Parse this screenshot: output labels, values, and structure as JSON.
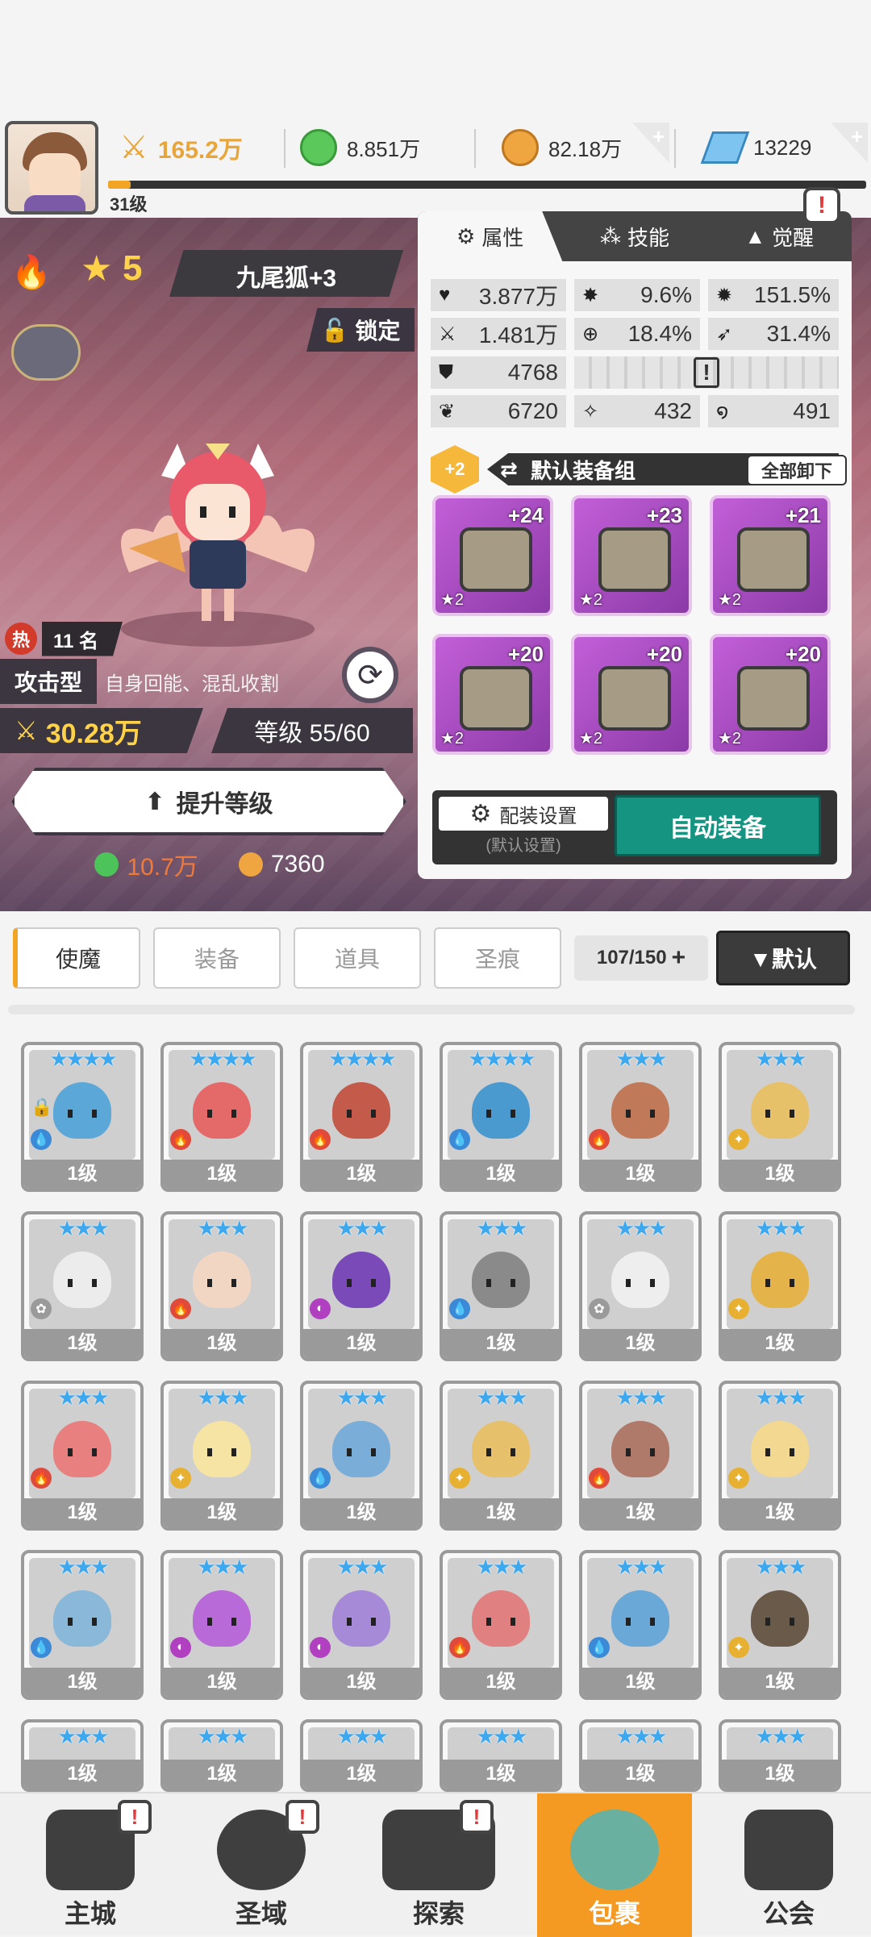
{
  "player": {
    "level": "31级",
    "exp_progress": 0.03
  },
  "resources": {
    "power": "165.2万",
    "green_gem": "8.851万",
    "gold": "82.18万",
    "diamond": "13229",
    "plus_glyph": "+"
  },
  "hero": {
    "element_icon": "fire-icon",
    "stars": "5",
    "star_glyph": "★",
    "name": "九尾狐+3",
    "lock_label": "锁定",
    "hot_label": "热",
    "hot_rank": "11 名",
    "role": "攻击型",
    "role_desc": "自身回能、混乱收割",
    "power": "30.28万",
    "level_text": "等级 55/60",
    "upgrade_label": "提升等级",
    "upgrade_cost_green": "10.7万",
    "upgrade_cost_gold": "7360"
  },
  "stats_panel": {
    "tabs": [
      {
        "label": "属性",
        "active": true
      },
      {
        "label": "技能",
        "active": false
      },
      {
        "label": "觉醒",
        "active": false
      }
    ],
    "stats_row1": [
      {
        "icon": "heart-icon",
        "glyph": "♥",
        "value": "3.877万"
      },
      {
        "icon": "crit-icon",
        "glyph": "✸",
        "value": "9.6%"
      },
      {
        "icon": "crit-damage-icon",
        "glyph": "✹",
        "value": "151.5%"
      }
    ],
    "stats_row2": [
      {
        "icon": "attack-icon",
        "glyph": "⚔",
        "value": "1.481万"
      },
      {
        "icon": "accuracy-icon",
        "glyph": "⊕",
        "value": "18.4%"
      },
      {
        "icon": "speed-icon",
        "glyph": "➶",
        "value": "31.4%"
      }
    ],
    "stats_row3": [
      {
        "icon": "defense-icon",
        "glyph": "⛊",
        "value": "4768"
      },
      {
        "icon": "warning-icon",
        "glyph": "!",
        "value": ""
      }
    ],
    "stats_row4": [
      {
        "icon": "energy-icon",
        "glyph": "❦",
        "value": "6720"
      },
      {
        "icon": "dodge-icon",
        "glyph": "✧",
        "value": "432"
      },
      {
        "icon": "spiral-icon",
        "glyph": "໑",
        "value": "491"
      }
    ],
    "gear_plus": "+2",
    "gear_set_label": "默认装备组",
    "unequip_all": "全部卸下",
    "gear": [
      {
        "name": "sword",
        "level": "+24",
        "stars": "★2"
      },
      {
        "name": "helmet",
        "level": "+23",
        "stars": "★2"
      },
      {
        "name": "armor",
        "level": "+21",
        "stars": "★2"
      },
      {
        "name": "belt",
        "level": "+20",
        "stars": "★2"
      },
      {
        "name": "amulet",
        "level": "+20",
        "stars": "★2"
      },
      {
        "name": "boots",
        "level": "+20",
        "stars": "★2"
      }
    ],
    "config_label": "配装设置",
    "config_sub": "(默认设置)",
    "auto_equip": "自动装备",
    "alert_glyph": "!"
  },
  "inventory": {
    "tabs": [
      "使魔",
      "装备",
      "道具",
      "圣痕"
    ],
    "count": "107/150",
    "count_plus": "+",
    "sort_label": "▼默认",
    "cards": [
      {
        "stars": "★★★★",
        "level": "1级",
        "element": "water",
        "color": "#5aa7d8",
        "locked": true
      },
      {
        "stars": "★★★★",
        "level": "1级",
        "element": "fire",
        "color": "#e46a6a",
        "locked": false
      },
      {
        "stars": "★★★★",
        "level": "1级",
        "element": "fire",
        "color": "#c45a4a",
        "locked": false
      },
      {
        "stars": "★★★★",
        "level": "1级",
        "element": "water",
        "color": "#4a9ad0",
        "locked": false
      },
      {
        "stars": "★★★",
        "level": "1级",
        "element": "fire",
        "color": "#c07a5a",
        "locked": false
      },
      {
        "stars": "★★★",
        "level": "1级",
        "element": "light",
        "color": "#e7c06a",
        "locked": false
      },
      {
        "stars": "★★★",
        "level": "1级",
        "element": "wind",
        "color": "#ececec",
        "locked": false
      },
      {
        "stars": "★★★",
        "level": "1级",
        "element": "fire",
        "color": "#f2d6c4",
        "locked": false
      },
      {
        "stars": "★★★",
        "level": "1级",
        "element": "dark",
        "color": "#7a4ab8",
        "locked": false
      },
      {
        "stars": "★★★",
        "level": "1级",
        "element": "water",
        "color": "#8a8a8a",
        "locked": false
      },
      {
        "stars": "★★★",
        "level": "1级",
        "element": "wind",
        "color": "#eeeeee",
        "locked": false
      },
      {
        "stars": "★★★",
        "level": "1级",
        "element": "light",
        "color": "#e4b44a",
        "locked": false
      },
      {
        "stars": "★★★",
        "level": "1级",
        "element": "fire",
        "color": "#e88080",
        "locked": false
      },
      {
        "stars": "★★★",
        "level": "1级",
        "element": "light",
        "color": "#f6e4a4",
        "locked": false
      },
      {
        "stars": "★★★",
        "level": "1级",
        "element": "water",
        "color": "#7aaed8",
        "locked": false
      },
      {
        "stars": "★★★",
        "level": "1级",
        "element": "light",
        "color": "#e6c06a",
        "locked": false
      },
      {
        "stars": "★★★",
        "level": "1级",
        "element": "fire",
        "color": "#b07a6a",
        "locked": false
      },
      {
        "stars": "★★★",
        "level": "1级",
        "element": "light",
        "color": "#f2d890",
        "locked": false
      },
      {
        "stars": "★★★",
        "level": "1级",
        "element": "water",
        "color": "#8ab8d8",
        "locked": false
      },
      {
        "stars": "★★★",
        "level": "1级",
        "element": "dark",
        "color": "#b86ad8",
        "locked": false
      },
      {
        "stars": "★★★",
        "level": "1级",
        "element": "dark",
        "color": "#a68ad8",
        "locked": false
      },
      {
        "stars": "★★★",
        "level": "1级",
        "element": "fire",
        "color": "#e08080",
        "locked": false
      },
      {
        "stars": "★★★",
        "level": "1级",
        "element": "water",
        "color": "#6aa8d8",
        "locked": false
      },
      {
        "stars": "★★★",
        "level": "1级",
        "element": "light",
        "color": "#6a5a4a",
        "locked": false
      },
      {
        "stars": "★★★",
        "level": "1级",
        "element": "light",
        "color": "#f0d080",
        "locked": false
      },
      {
        "stars": "★★★",
        "level": "1级",
        "element": "water",
        "color": "#4a6aa8",
        "locked": false
      },
      {
        "stars": "★★★",
        "level": "1级",
        "element": "dark",
        "color": "#e0b050",
        "locked": false
      },
      {
        "stars": "★★★",
        "level": "1级",
        "element": "dark",
        "color": "#7a5a4a",
        "locked": false
      },
      {
        "stars": "★★★",
        "level": "1级",
        "element": "fire",
        "color": "#d88080",
        "locked": false
      },
      {
        "stars": "★★★",
        "level": "1级",
        "element": "light",
        "color": "#f0e0b0",
        "locked": false
      }
    ]
  },
  "bottom_nav": [
    {
      "label": "主城",
      "badge": "!"
    },
    {
      "label": "圣域",
      "badge": "!"
    },
    {
      "label": "探索",
      "badge": "!"
    },
    {
      "label": "包裹",
      "badge": "",
      "active": true
    },
    {
      "label": "公会",
      "badge": ""
    }
  ],
  "colors": {
    "accent_orange": "#f49a22",
    "auto_equip_teal": "#149481",
    "star_blue": "#3ba8f0",
    "gold": "#ffd24a"
  }
}
